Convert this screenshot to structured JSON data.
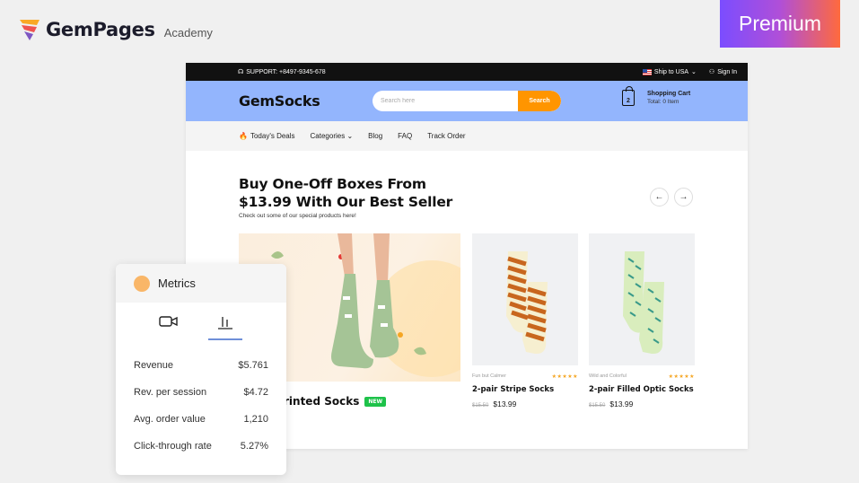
{
  "branding": {
    "logo_main": "GemPages",
    "logo_sub": "Academy",
    "premium_label": "Premium"
  },
  "site": {
    "topbar": {
      "support": "SUPPORT: +8497-9345-678",
      "ship_to": "Ship to USA",
      "sign_in": "Sign In"
    },
    "header": {
      "brand": "GemSocks",
      "search_placeholder": "Search here",
      "search_button": "Search",
      "cart_title": "Shopping Cart",
      "cart_total": "Total: 0 Item",
      "cart_count": "2"
    },
    "nav": [
      "Today's Deals",
      "Categories",
      "Blog",
      "FAQ",
      "Track Order"
    ],
    "hero": {
      "title_line1": "Buy One-Off Boxes From",
      "title_line2": "$13.99 With Our Best Seller",
      "subtitle": "Check out some of our special products here!"
    },
    "featured": {
      "name_visible": "rinted Socks",
      "badge": "NEW"
    },
    "products": [
      {
        "vendor": "Fun but Calmer",
        "rating": "★★★★★",
        "name": "2-pair Stripe Socks",
        "old_price": "$15.50",
        "price": "$13.99",
        "color_main": "#c8661e",
        "color_alt": "#f6efd0"
      },
      {
        "vendor": "Wild and Colorful",
        "rating": "★★★★★",
        "name": "2-pair Filled Optic Socks",
        "old_price": "$15.50",
        "price": "$13.99",
        "color_main": "#d9edbd",
        "color_alt": "#3a9a8a"
      }
    ]
  },
  "metrics": {
    "title": "Metrics",
    "rows": [
      {
        "label": "Revenue",
        "value": "$5.761"
      },
      {
        "label": "Rev. per session",
        "value": "$4.72"
      },
      {
        "label": "Avg. order value",
        "value": "1,210"
      },
      {
        "label": "Click-through rate",
        "value": "5.27%"
      }
    ]
  },
  "colors": {
    "header_bg": "#93b5fd",
    "accent": "#ff9500",
    "badge_green": "#1ec24a"
  }
}
